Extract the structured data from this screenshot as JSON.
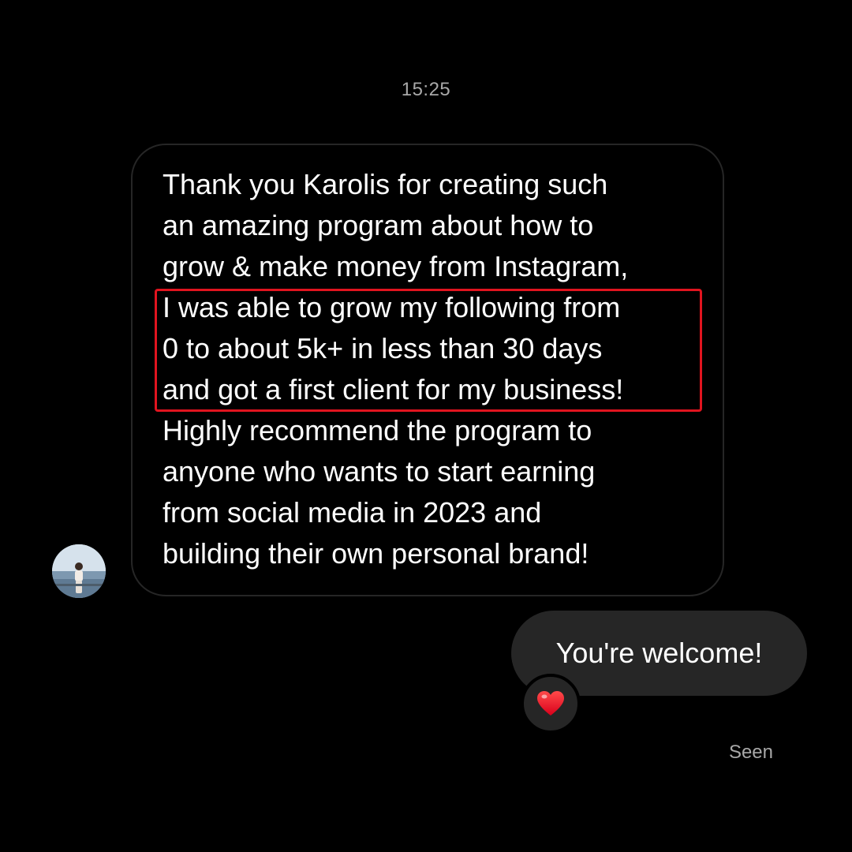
{
  "conversation": {
    "timestamp": "15:25",
    "incoming_message": {
      "lines": [
        "Thank you Karolis for creating such",
        "an amazing program about how to",
        "grow & make money from Instagram,",
        "I was able to grow my following from",
        "0 to about 5k+ in less than 30 days",
        "and got a first client for my business!",
        "Highly recommend the program to",
        "anyone who wants to start earning",
        "from social media in 2023 and",
        "building their own personal brand!"
      ],
      "highlight_color": "#e0141f"
    },
    "outgoing_message": {
      "text": "You're welcome!",
      "reaction": "heart-icon"
    },
    "status": "Seen"
  },
  "colors": {
    "background": "#000000",
    "outgoing_bubble": "#262626",
    "incoming_border": "#262626",
    "secondary_text": "#a8a8a8"
  }
}
